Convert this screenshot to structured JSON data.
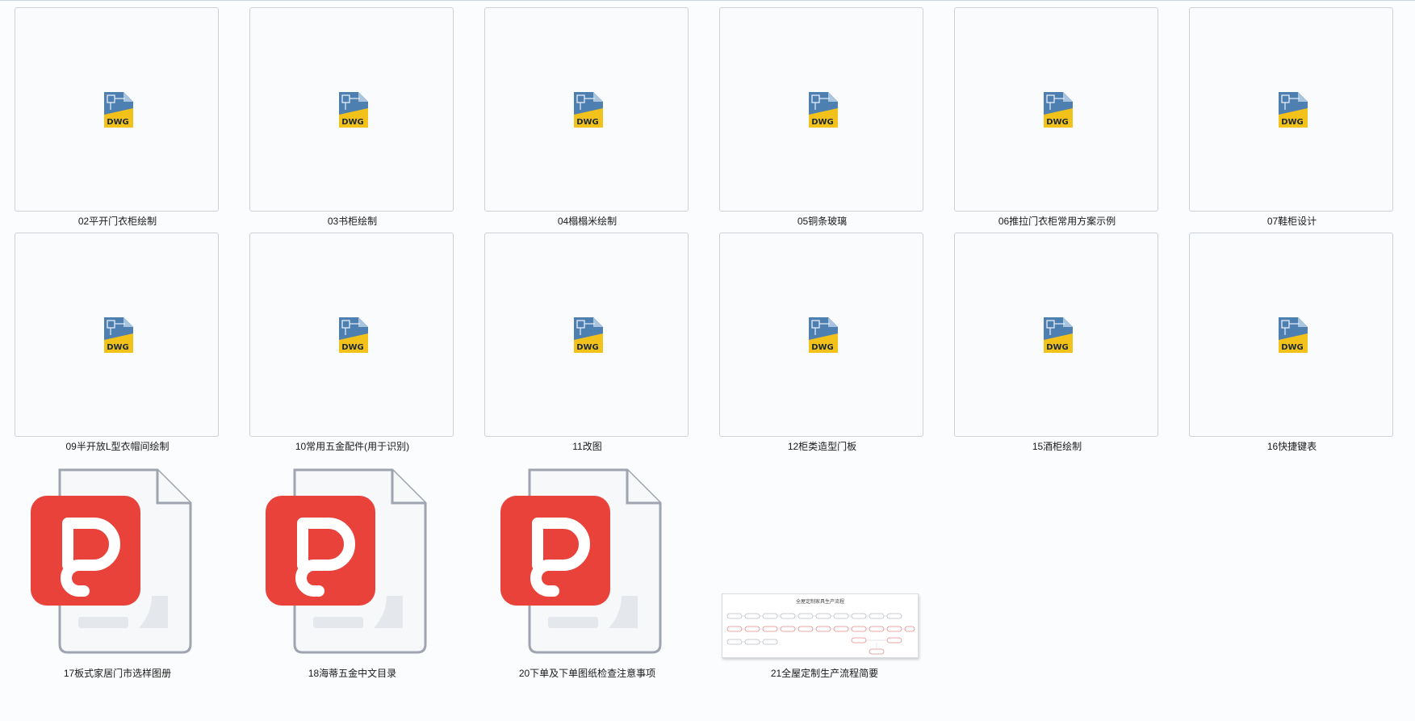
{
  "files": [
    {
      "name": "02平开门衣柜绘制",
      "type": "dwg",
      "icon": "dwg-file-icon"
    },
    {
      "name": "03书柜绘制",
      "type": "dwg",
      "icon": "dwg-file-icon"
    },
    {
      "name": "04榻榻米绘制",
      "type": "dwg",
      "icon": "dwg-file-icon"
    },
    {
      "name": "05铜条玻璃",
      "type": "dwg",
      "icon": "dwg-file-icon"
    },
    {
      "name": "06推拉门衣柜常用方案示例",
      "type": "dwg",
      "icon": "dwg-file-icon"
    },
    {
      "name": "07鞋柜设计",
      "type": "dwg",
      "icon": "dwg-file-icon"
    },
    {
      "name": "09半开放L型衣帽间绘制",
      "type": "dwg",
      "icon": "dwg-file-icon"
    },
    {
      "name": "10常用五金配件(用于识别)",
      "type": "dwg",
      "icon": "dwg-file-icon"
    },
    {
      "name": "11改图",
      "type": "dwg",
      "icon": "dwg-file-icon"
    },
    {
      "name": "12柜类造型门板",
      "type": "dwg",
      "icon": "dwg-file-icon"
    },
    {
      "name": "15酒柜绘制",
      "type": "dwg",
      "icon": "dwg-file-icon"
    },
    {
      "name": "16快捷键表",
      "type": "dwg",
      "icon": "dwg-file-icon"
    },
    {
      "name": "17板式家居门市选样图册",
      "type": "pdf",
      "icon": "wps-pdf-file-icon"
    },
    {
      "name": "18海蒂五金中文目录",
      "type": "pdf",
      "icon": "wps-pdf-file-icon"
    },
    {
      "name": "20下单及下单图纸检查注意事项",
      "type": "pdf",
      "icon": "wps-pdf-file-icon"
    },
    {
      "name": "21全屋定制生产流程简要",
      "type": "image",
      "icon": "flowchart-thumbnail",
      "thumbnail_title": "全屋定制家具生产流程"
    }
  ],
  "colors": {
    "background": "#fbfcfd",
    "thumb_border": "#cdd2d8",
    "pdf_red": "#e8423a",
    "dwg_blue": "#2f5d8c",
    "dwg_yellow": "#f2c21b"
  }
}
